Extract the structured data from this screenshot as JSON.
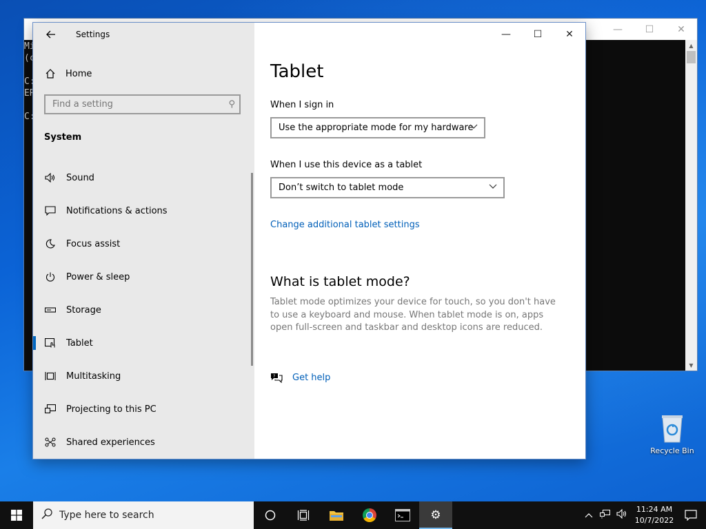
{
  "desktop": {
    "recycle_bin_label": "Recycle Bin"
  },
  "console": {
    "lines": [
      "Mi",
      "(c",
      "",
      "C:",
      "ER",
      "",
      "C:"
    ],
    "buttons": {
      "minimize": "—",
      "maximize": "☐",
      "close": "✕"
    }
  },
  "settings": {
    "window_title": "Settings",
    "controls": {
      "minimize": "—",
      "maximize": "☐",
      "close": "✕"
    },
    "sidebar": {
      "home_label": "Home",
      "search_placeholder": "Find a setting",
      "group_label": "System",
      "items": [
        {
          "label": "Sound",
          "icon": "speaker-icon"
        },
        {
          "label": "Notifications & actions",
          "icon": "notification-icon"
        },
        {
          "label": "Focus assist",
          "icon": "moon-icon"
        },
        {
          "label": "Power & sleep",
          "icon": "power-icon"
        },
        {
          "label": "Storage",
          "icon": "storage-icon"
        },
        {
          "label": "Tablet",
          "icon": "tablet-icon",
          "active": true
        },
        {
          "label": "Multitasking",
          "icon": "multitasking-icon"
        },
        {
          "label": "Projecting to this PC",
          "icon": "projecting-icon"
        },
        {
          "label": "Shared experiences",
          "icon": "shared-icon"
        }
      ]
    },
    "main": {
      "title": "Tablet",
      "sign_in_label": "When I sign in",
      "sign_in_value": "Use the appropriate mode for my hardware",
      "tablet_use_label": "When I use this device as a tablet",
      "tablet_use_value": "Don’t switch to tablet mode",
      "change_link": "Change additional tablet settings",
      "what_heading": "What is tablet mode?",
      "what_desc": "Tablet mode optimizes your device for touch, so you don't have to use a keyboard and mouse. When tablet mode is on, apps open full-screen and taskbar and desktop icons are reduced.",
      "help_label": "Get help"
    }
  },
  "taskbar": {
    "search_placeholder": "Type here to search",
    "time": "11:24 AM",
    "date": "10/7/2022",
    "accent": "#76b9ed"
  }
}
